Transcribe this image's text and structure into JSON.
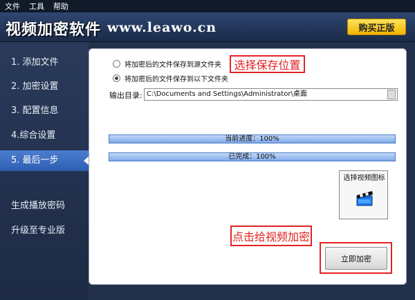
{
  "menu": [
    "文件",
    "工具",
    "帮助"
  ],
  "header": {
    "app_title": "视频加密软件",
    "site": "www.leawo.cn",
    "buy_label": "购买正版"
  },
  "sidebar": {
    "items": [
      {
        "label": "1. 添加文件"
      },
      {
        "label": "2. 加密设置"
      },
      {
        "label": "3. 配置信息"
      },
      {
        "label": "4.综合设置"
      },
      {
        "label": "5. 最后一步"
      },
      {
        "label": "生成播放密码"
      },
      {
        "label": "升级至专业版"
      }
    ],
    "active_index": 4
  },
  "panel": {
    "radio_options": [
      {
        "label": "将加密后的文件保存到源文件夹",
        "checked": false
      },
      {
        "label": "将加密后的文件保存到以下文件夹",
        "checked": true
      }
    ],
    "annotation_save": "选择保存位置",
    "output_label": "输出目录:",
    "output_value": "C:\\Documents and Settings\\Administrator\\桌面",
    "progress_current": {
      "text": "当前进度：100%",
      "percent": 100
    },
    "progress_total": {
      "text": "已完成：100%",
      "percent": 100
    },
    "icon_box_label": "选择视频图标",
    "annotation_encrypt": "点击给视频加密",
    "encrypt_label": "立即加密"
  }
}
